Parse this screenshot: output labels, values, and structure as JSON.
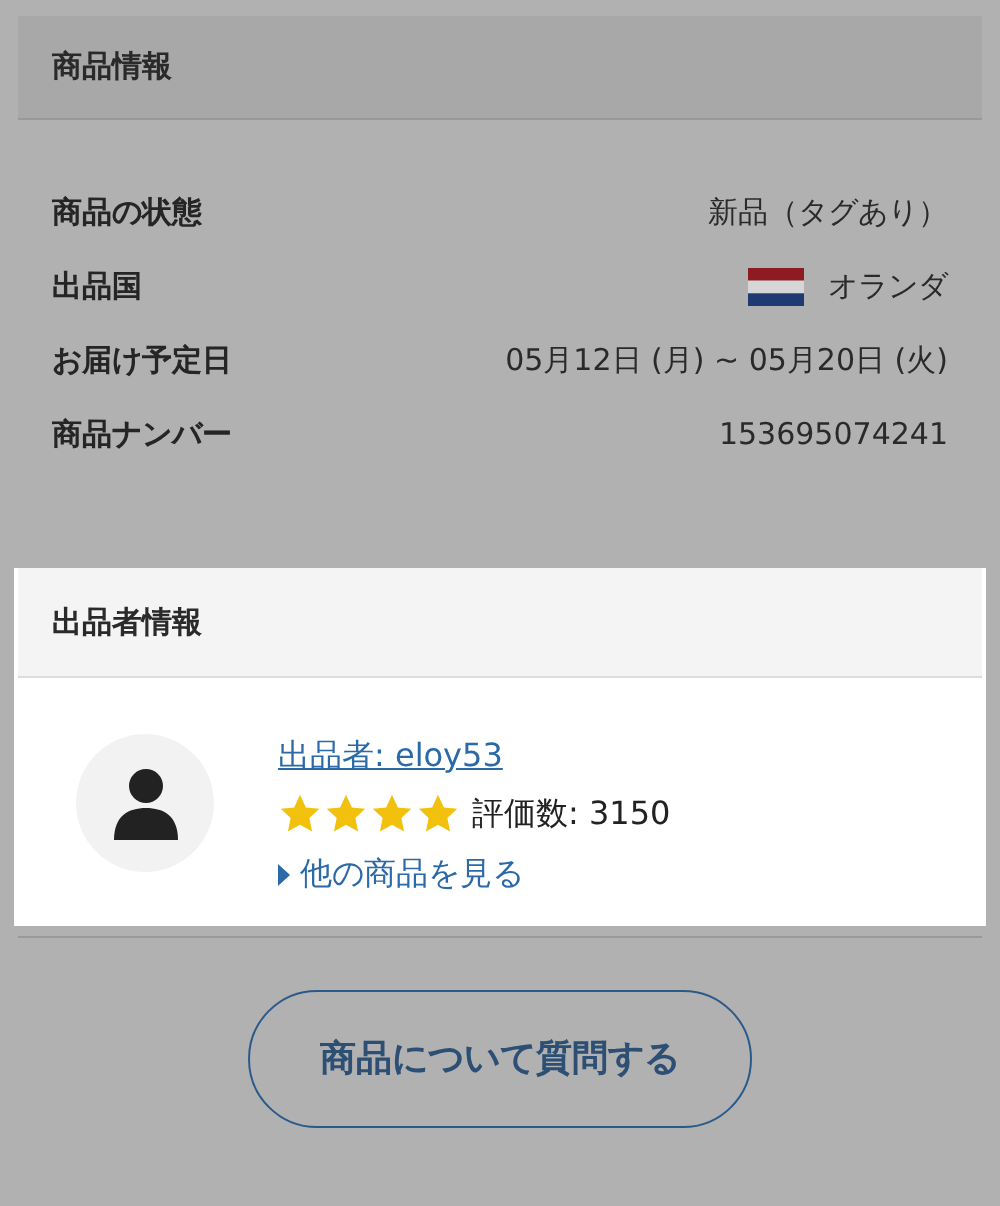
{
  "product_info": {
    "title": "商品情報",
    "highlighted": false,
    "rows": [
      {
        "label": "商品の状態",
        "value": "新品（タグあり）"
      },
      {
        "label": "出品国",
        "value": "オランダ",
        "kind": "flag"
      },
      {
        "label": "お届け予定日",
        "value": "05月12日 (月) ~ 05月20日 (火)"
      },
      {
        "label": "商品ナンバー",
        "value": "153695074241"
      }
    ]
  },
  "seller_info": {
    "title": "出品者情報",
    "highlighted": true,
    "seller_link": "出品者: eloy53",
    "stars": 4,
    "rating_count": "評価数: 3150",
    "more_link": "他の商品を見る"
  },
  "question_button": "商品について質問する"
}
